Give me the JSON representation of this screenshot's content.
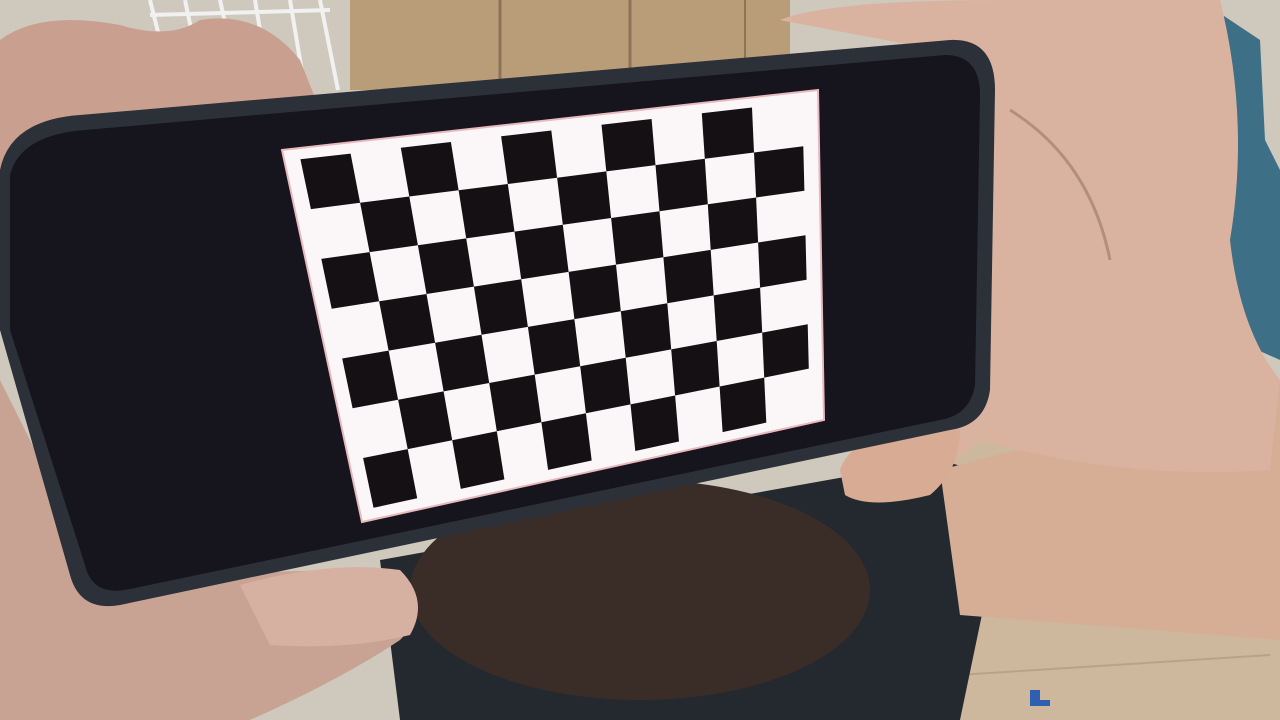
{
  "scene": {
    "subject": "phone-displaying-checkerboard",
    "checkerboard": {
      "rows": 7,
      "cols": 10,
      "top_left_square": "black",
      "colors": {
        "dark": "#141014",
        "light": "#fbf7f8",
        "border_tint": "#e9b9bd"
      }
    },
    "colors": {
      "phone_body": "#16141c",
      "phone_rim": "#2c3038",
      "skin": "#d9b3a0",
      "skin_shadow": "#b08a7a",
      "shirt": "#23292f",
      "hair": "#3a2d27",
      "wood_floor": "#c9b49b",
      "cabinet": "#b99c78",
      "wall": "#d8d2c6",
      "chair_blue": "#3d6f86"
    }
  }
}
